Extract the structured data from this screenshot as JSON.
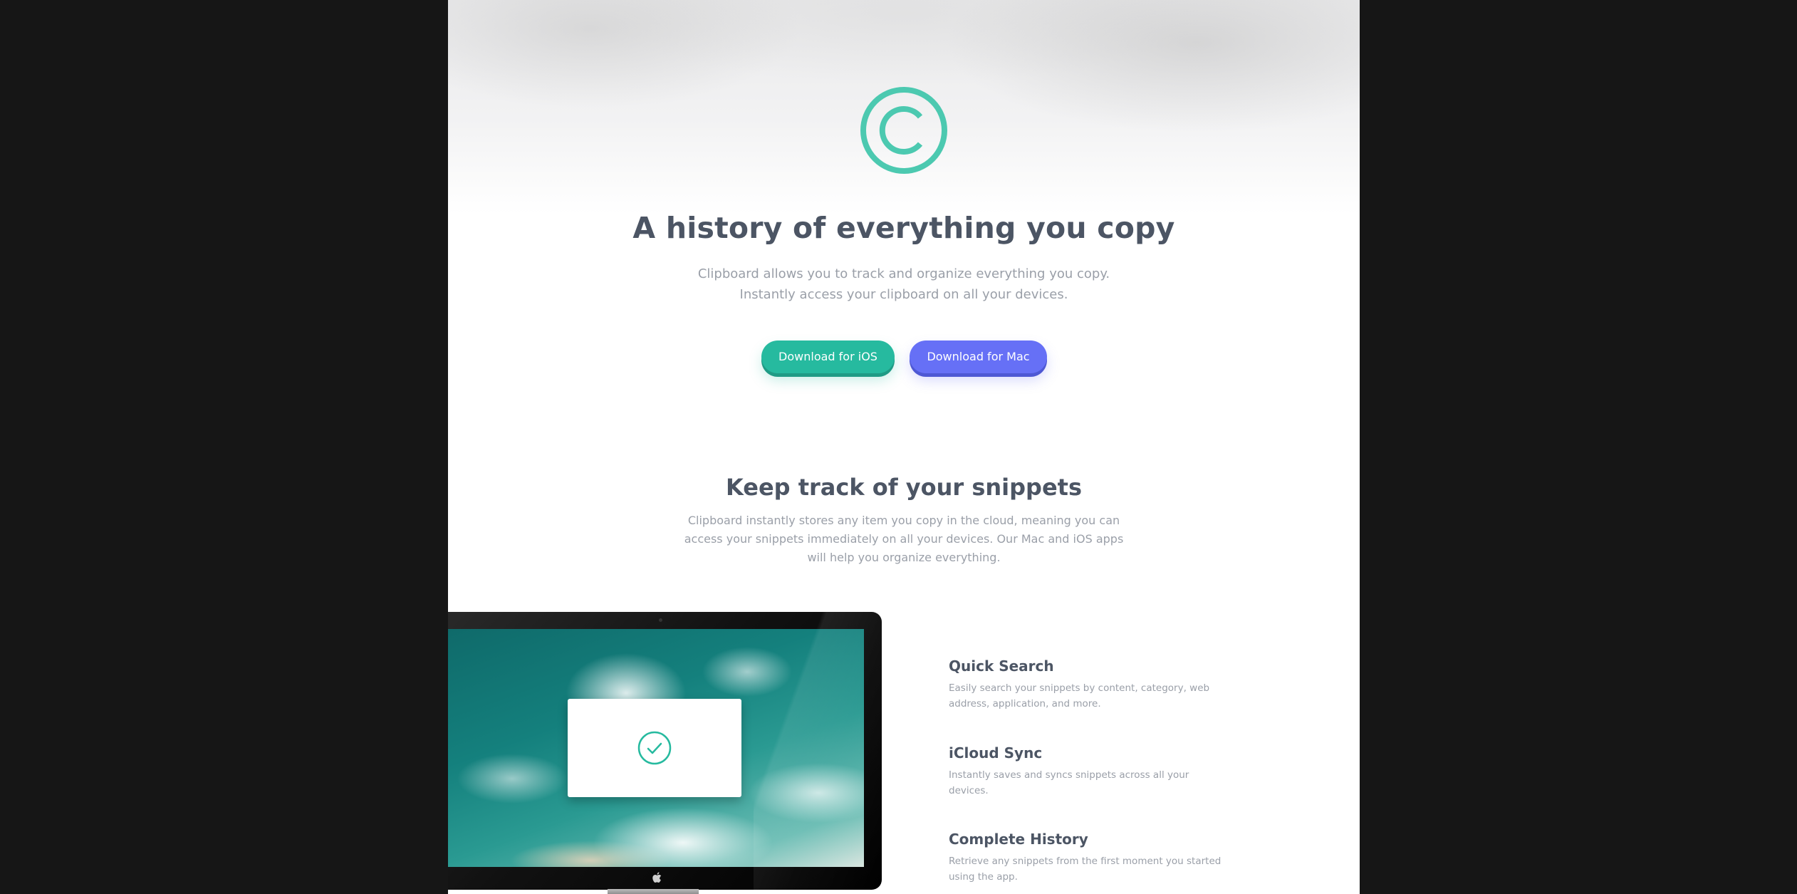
{
  "hero": {
    "title": "A history of everything you copy",
    "subtitle": "Clipboard allows you to track and organize everything you copy. Instantly access your clipboard on all your devices.",
    "buttons": {
      "ios_label": "Download for iOS",
      "mac_label": "Download for Mac"
    }
  },
  "snippets": {
    "title": "Keep track of your snippets",
    "subtitle": "Clipboard instantly stores any item you copy in the cloud, meaning you can access your snippets immediately on all your devices. Our Mac and iOS apps will help you organize everything."
  },
  "features": [
    {
      "title": "Quick Search",
      "description": "Easily search your snippets by content, category, web address, application, and more."
    },
    {
      "title": "iCloud Sync",
      "description": "Instantly saves and syncs snippets across all your devices."
    },
    {
      "title": "Complete History",
      "description": "Retrieve any snippets from the first moment you started using the app."
    }
  ],
  "icons": {
    "logo": "copyright-logo-icon",
    "check": "checkmark-circle-icon",
    "apple": "apple-logo-icon"
  },
  "colors": {
    "accent_green": "#26ba9f",
    "accent_blue": "#6670f6",
    "heading": "#4c5564",
    "body_text": "#9a9fa8",
    "backdrop": "#161616"
  }
}
